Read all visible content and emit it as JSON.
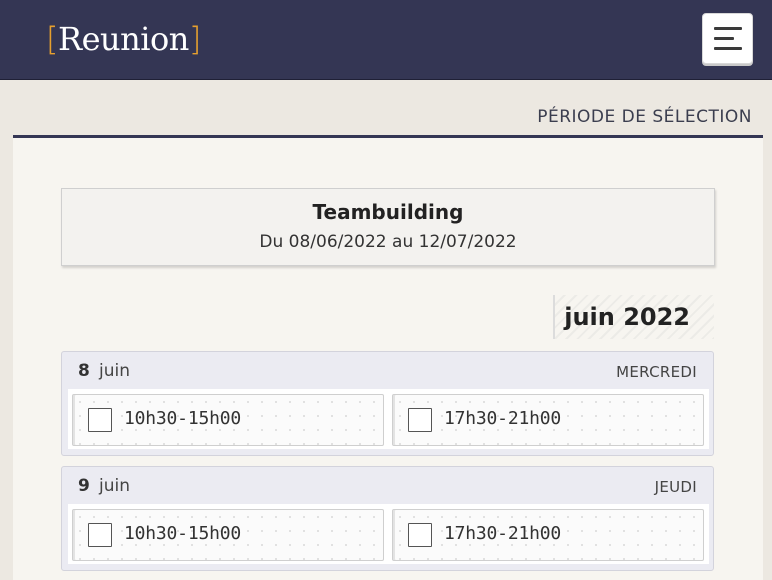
{
  "header": {
    "logo_open": "[",
    "logo_text": "Reunion",
    "logo_close": "]",
    "menu_icon": "hamburger-menu-icon"
  },
  "section": {
    "title": "PÉRIODE DE SÉLECTION"
  },
  "event": {
    "title": "Teambuilding",
    "dates": "Du 08/06/2022 au 12/07/2022"
  },
  "month": {
    "label": "juin 2022"
  },
  "days": [
    {
      "num": "8",
      "month": "juin",
      "weekday": "MERCREDI",
      "slots": [
        {
          "label": "10h30-15h00",
          "checked": false
        },
        {
          "label": "17h30-21h00",
          "checked": false
        }
      ]
    },
    {
      "num": "9",
      "month": "juin",
      "weekday": "JEUDI",
      "slots": [
        {
          "label": "10h30-15h00",
          "checked": false
        },
        {
          "label": "17h30-21h00",
          "checked": false
        }
      ]
    }
  ],
  "colors": {
    "header_bg": "#343654",
    "accent_bracket": "#e7a02e",
    "day_bg": "#ebebf2"
  }
}
